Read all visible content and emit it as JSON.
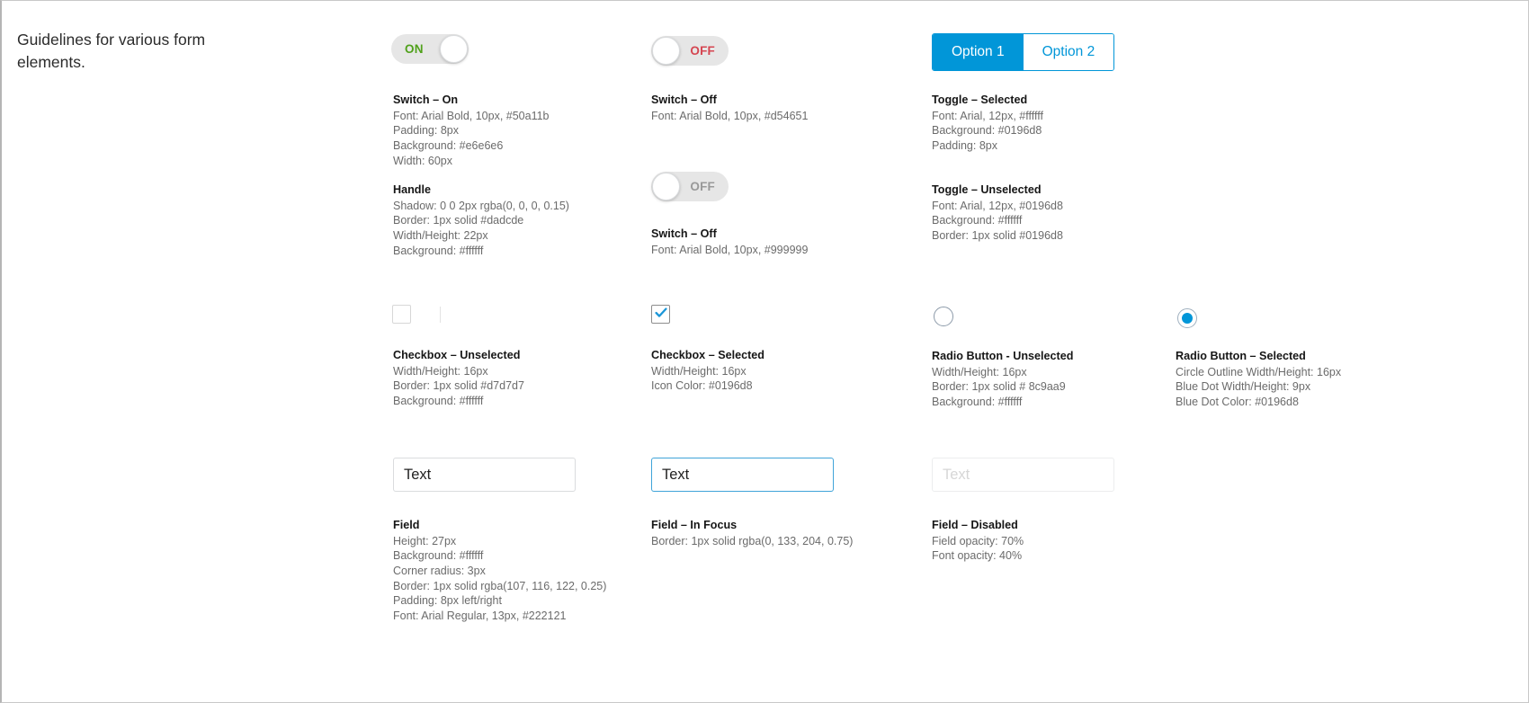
{
  "intro": {
    "text": "Guidelines for various form elements."
  },
  "switch_on": {
    "label": "ON",
    "caption": {
      "title": "Switch – On",
      "lines": [
        "Font: Arial Bold, 10px, #50a11b",
        "Padding: 8px",
        "Background: #e6e6e6",
        "Width: 60px"
      ]
    }
  },
  "handle": {
    "caption": {
      "title": "Handle",
      "lines": [
        "Shadow: 0 0 2px rgba(0, 0, 0, 0.15)",
        "Border: 1px solid #dadcde",
        "Width/Height: 22px",
        "Background: #ffffff"
      ]
    }
  },
  "switch_off_red": {
    "label": "OFF",
    "caption": {
      "title": "Switch – Off",
      "lines": [
        "Font: Arial Bold, 10px, #d54651"
      ]
    }
  },
  "switch_off_grey": {
    "label": "OFF",
    "caption": {
      "title": "Switch – Off",
      "lines": [
        "Font: Arial Bold, 10px, #999999"
      ]
    }
  },
  "toggle": {
    "option_selected": "Option 1",
    "option_unselected": "Option 2",
    "caption_selected": {
      "title": "Toggle – Selected",
      "lines": [
        "Font: Arial, 12px, #ffffff",
        "Background: #0196d8",
        "Padding: 8px"
      ]
    },
    "caption_unselected": {
      "title": "Toggle – Unselected",
      "lines": [
        "Font: Arial, 12px, #0196d8",
        "Background: #ffffff",
        "Border: 1px solid #0196d8"
      ]
    }
  },
  "checkbox_unselected": {
    "caption": {
      "title": "Checkbox – Unselected",
      "lines": [
        "Width/Height: 16px",
        "Border: 1px solid #d7d7d7",
        "Background: #ffffff"
      ]
    }
  },
  "checkbox_selected": {
    "caption": {
      "title": "Checkbox – Selected",
      "lines": [
        "Width/Height: 16px",
        "Icon Color: #0196d8"
      ]
    }
  },
  "radio_unselected": {
    "caption": {
      "title": "Radio Button - Unselected",
      "lines": [
        "Width/Height: 16px",
        "Border: 1px solid # 8c9aa9",
        "Background: #ffffff"
      ]
    }
  },
  "radio_selected": {
    "caption": {
      "title": "Radio Button – Selected",
      "lines": [
        "Circle Outline Width/Height: 16px",
        "Blue Dot Width/Height: 9px",
        "Blue Dot Color: #0196d8"
      ]
    }
  },
  "field_default": {
    "value": "Text",
    "caption": {
      "title": "Field",
      "lines": [
        "Height: 27px",
        "Background: #ffffff",
        "Corner radius: 3px",
        "Border: 1px solid rgba(107, 116, 122, 0.25)",
        "Padding: 8px left/right",
        "Font: Arial Regular, 13px, #222121"
      ]
    }
  },
  "field_focus": {
    "value": "Text",
    "caption": {
      "title": "Field – In Focus",
      "lines": [
        "Border: 1px solid rgba(0, 133, 204, 0.75)"
      ]
    }
  },
  "field_disabled": {
    "value": "Text",
    "caption": {
      "title": "Field – Disabled",
      "lines": [
        "Field opacity: 70%",
        "Font opacity: 40%"
      ]
    }
  },
  "colors": {
    "accent_blue": "#0196d8",
    "green": "#50a11b",
    "red": "#d54651",
    "grey_label": "#999999",
    "switch_track": "#e6e6e6",
    "handle_border": "#dadcde",
    "checkbox_border": "#d7d7d7",
    "radio_border": "#8c9aa9",
    "text_dark": "#222121"
  }
}
